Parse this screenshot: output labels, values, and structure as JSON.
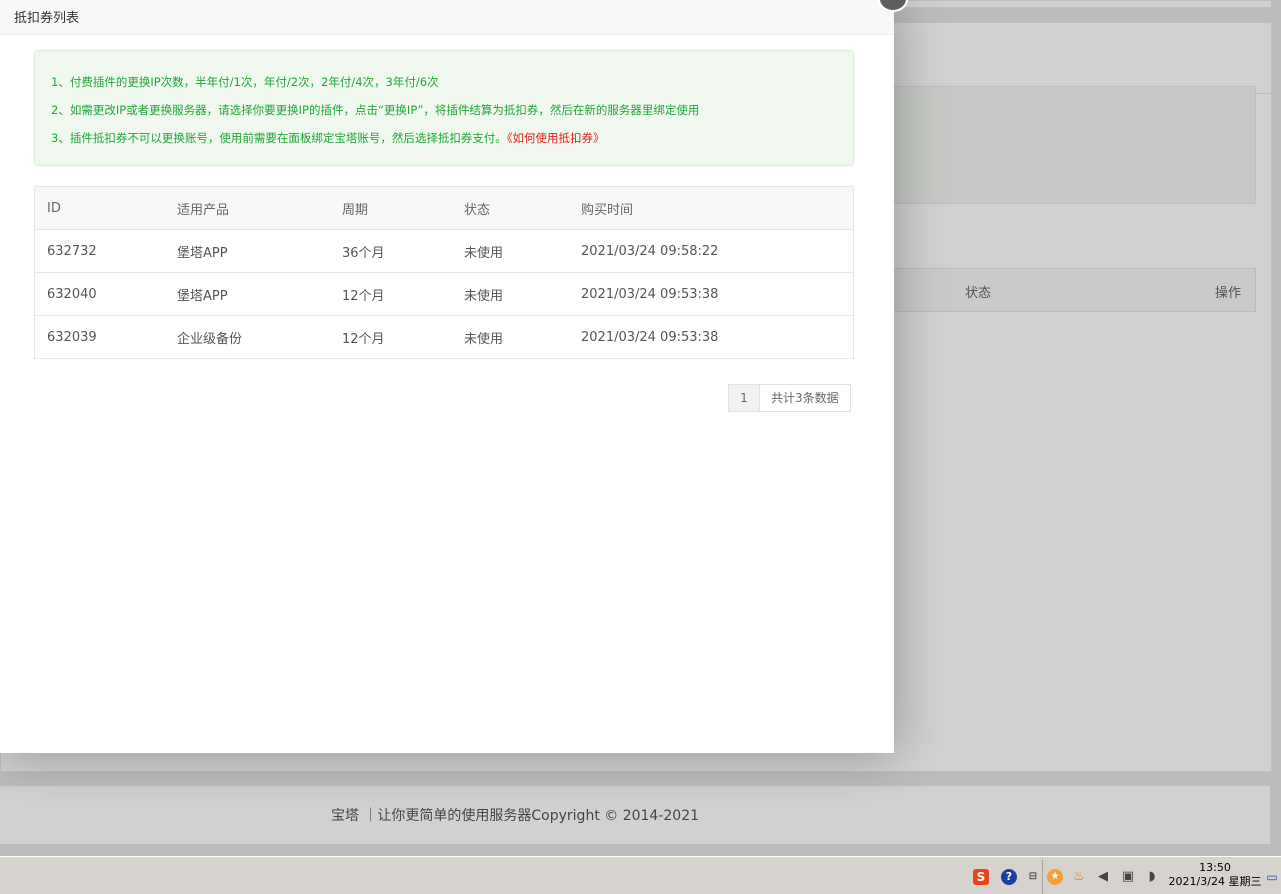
{
  "background": {
    "table_headers": [
      "状态",
      "操作"
    ],
    "footer_text": "宝塔 ｜让你更简单的使用服务器Copyright © 2014-2021"
  },
  "modal": {
    "title": "抵扣券列表",
    "notice": {
      "line1": "1、付费插件的更换IP次数，半年付/1次，年付/2次，2年付/4次，3年付/6次",
      "line2": "2、如需更改IP或者更换服务器，请选择你要更换IP的插件，点击“更换IP”，将插件结算为抵扣券，然后在新的服务器里绑定使用",
      "line3": "3、插件抵扣券不可以更换账号，使用前需要在面板绑定宝塔账号，然后选择抵扣券支付。",
      "line3_link": "《如何使用抵扣券》"
    },
    "table": {
      "headers": [
        "ID",
        "适用产品",
        "周期",
        "状态",
        "购买时间"
      ],
      "rows": [
        {
          "id": "632732",
          "product": "堡塔APP",
          "period": "36个月",
          "status": "未使用",
          "time": "2021/03/24 09:58:22"
        },
        {
          "id": "632040",
          "product": "堡塔APP",
          "period": "12个月",
          "status": "未使用",
          "time": "2021/03/24 09:53:38"
        },
        {
          "id": "632039",
          "product": "企业级备份",
          "period": "12个月",
          "status": "未使用",
          "time": "2021/03/24 09:53:38"
        }
      ]
    },
    "pagination": {
      "current": "1",
      "total_text": "共计3条数据"
    }
  },
  "taskbar": {
    "time": "13:50",
    "date": "2021/3/24 星期三",
    "icons": [
      "sogou-ime-icon",
      "help-icon",
      "language-icon",
      "tray-orange-icon",
      "tray-flame-icon",
      "volume-icon",
      "network-icon",
      "sound-wave-icon",
      "desktop-icon"
    ]
  }
}
